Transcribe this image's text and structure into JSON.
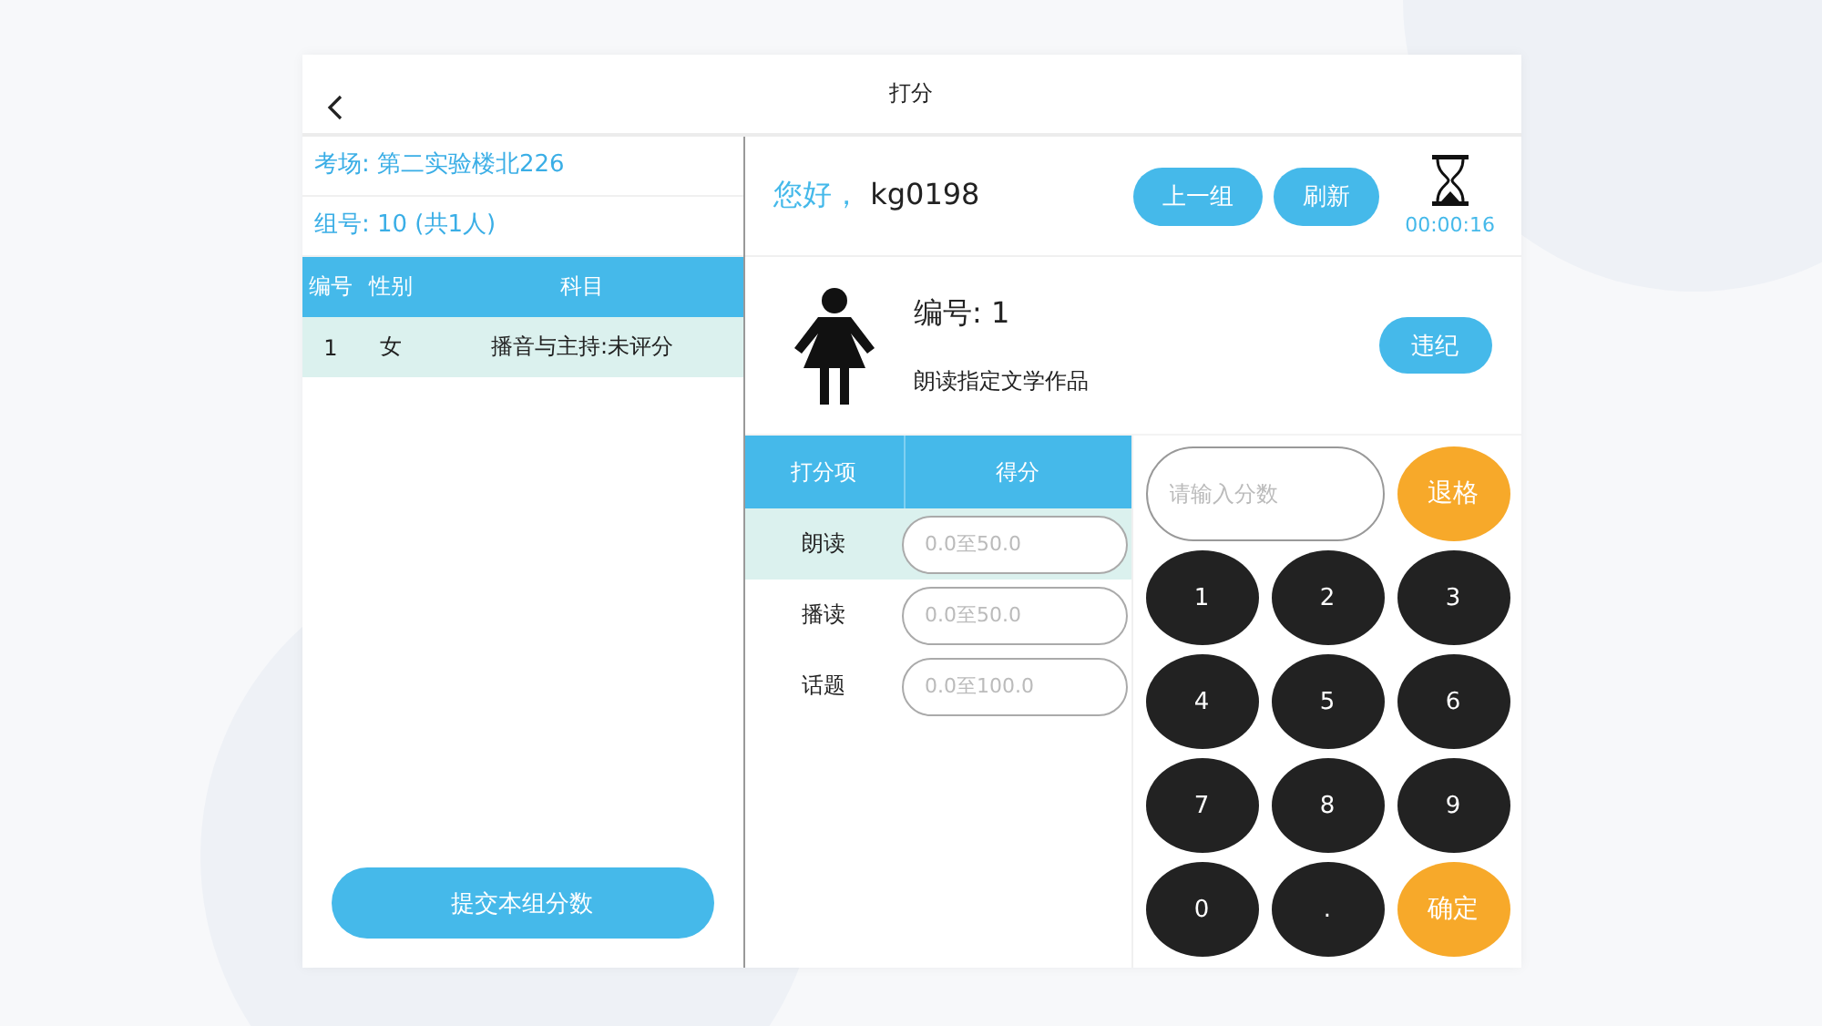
{
  "header": {
    "title": "打分"
  },
  "left": {
    "venue": "考场: 第二实验楼北226",
    "group": "组号: 10 (共1人)",
    "columns": [
      "编号",
      "性别",
      "科目"
    ],
    "rows": [
      {
        "cells": [
          "1",
          "女",
          "播音与主持:未评分"
        ],
        "selected": true
      }
    ],
    "submit": "提交本组分数"
  },
  "top": {
    "greeting": "您好，",
    "user": "kg0198",
    "buttons": [
      "上一组",
      "刷新"
    ],
    "timer": "00:00:16"
  },
  "student": {
    "number": "编号: 1",
    "task": "朗读指定文学作品",
    "violation": "违纪"
  },
  "score_table": {
    "columns": [
      "打分项",
      "得分"
    ],
    "rows": [
      {
        "item": "朗读",
        "placeholder": "0.0至50.0",
        "selected": true
      },
      {
        "item": "播读",
        "placeholder": "0.0至50.0",
        "selected": false
      },
      {
        "item": "话题",
        "placeholder": "0.0至100.0",
        "selected": false
      }
    ]
  },
  "keypad": {
    "placeholder": "请输入分数",
    "keys": [
      {
        "label": "退格",
        "kind": "action"
      },
      {
        "label": "1",
        "kind": "digit"
      },
      {
        "label": "2",
        "kind": "digit"
      },
      {
        "label": "3",
        "kind": "digit"
      },
      {
        "label": "4",
        "kind": "digit"
      },
      {
        "label": "5",
        "kind": "digit"
      },
      {
        "label": "6",
        "kind": "digit"
      },
      {
        "label": "7",
        "kind": "digit"
      },
      {
        "label": "8",
        "kind": "digit"
      },
      {
        "label": "9",
        "kind": "digit"
      },
      {
        "label": "0",
        "kind": "digit"
      },
      {
        "label": ".",
        "kind": "digit"
      },
      {
        "label": "确定",
        "kind": "action"
      }
    ]
  }
}
